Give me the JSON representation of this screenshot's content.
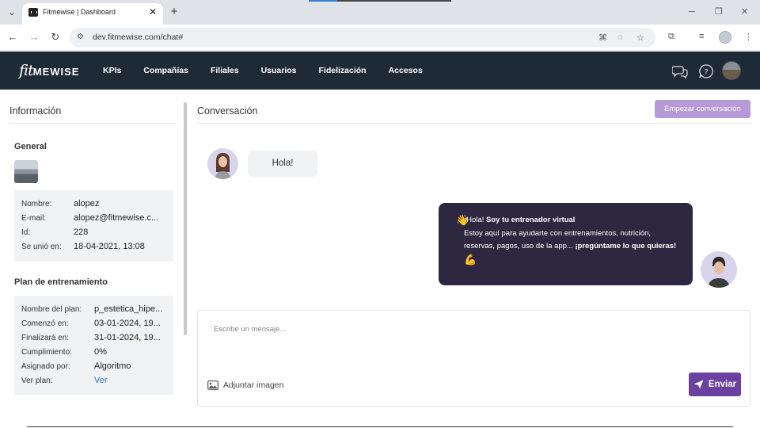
{
  "browser": {
    "tab_title": "Fitmewise | Dashboard",
    "url": "dev.fitmewise.com/chat#"
  },
  "app": {
    "logo_script": "fit",
    "logo_word": "MEWISE",
    "nav": [
      "KPIs",
      "Compañías",
      "Filiales",
      "Usuarios",
      "Fidelización",
      "Accesos"
    ],
    "icons": [
      "chat-bubbles-icon",
      "help-circle-icon",
      "user-avatar"
    ]
  },
  "left": {
    "title": "Información",
    "general_title": "General",
    "general": [
      {
        "key": "Nombre:",
        "value": "alopez"
      },
      {
        "key": "E-mail:",
        "value": "alopez@fitmewise.c..."
      },
      {
        "key": "Id:",
        "value": "228"
      },
      {
        "key": "Se unió en:",
        "value": "18-04-2021, 13:08"
      }
    ],
    "plan_title": "Plan de entrenamiento",
    "plan": [
      {
        "key": "Nombre del plan:",
        "value": "p_estetica_hipe..."
      },
      {
        "key": "Comenzó en:",
        "value": "03-01-2024, 19..."
      },
      {
        "key": "Finalizará en:",
        "value": "31-01-2024, 19..."
      },
      {
        "key": "Cumplimiento:",
        "value": "0%"
      },
      {
        "key": "Asignado por:",
        "value": "Algoritmo"
      },
      {
        "key": "Ver plan:",
        "value": "Ver"
      }
    ]
  },
  "chat": {
    "title": "Conversación",
    "start_button": "Empezar conversación",
    "user_message": "Hola!",
    "bot_message": {
      "greeting": "¡Hola! ",
      "greeting_bold": "Soy tu entrenador virtual",
      "body": "Estoy aquí para ayudarte con entrenamientos, nutrición, reservas, pagos, uso de la app... ",
      "body_bold": "¡pregúntame lo que quieras!"
    },
    "composer_placeholder": "Escribe un mensaje...",
    "attach_label": "Adjuntar imagen",
    "send_label": "Enviar"
  }
}
